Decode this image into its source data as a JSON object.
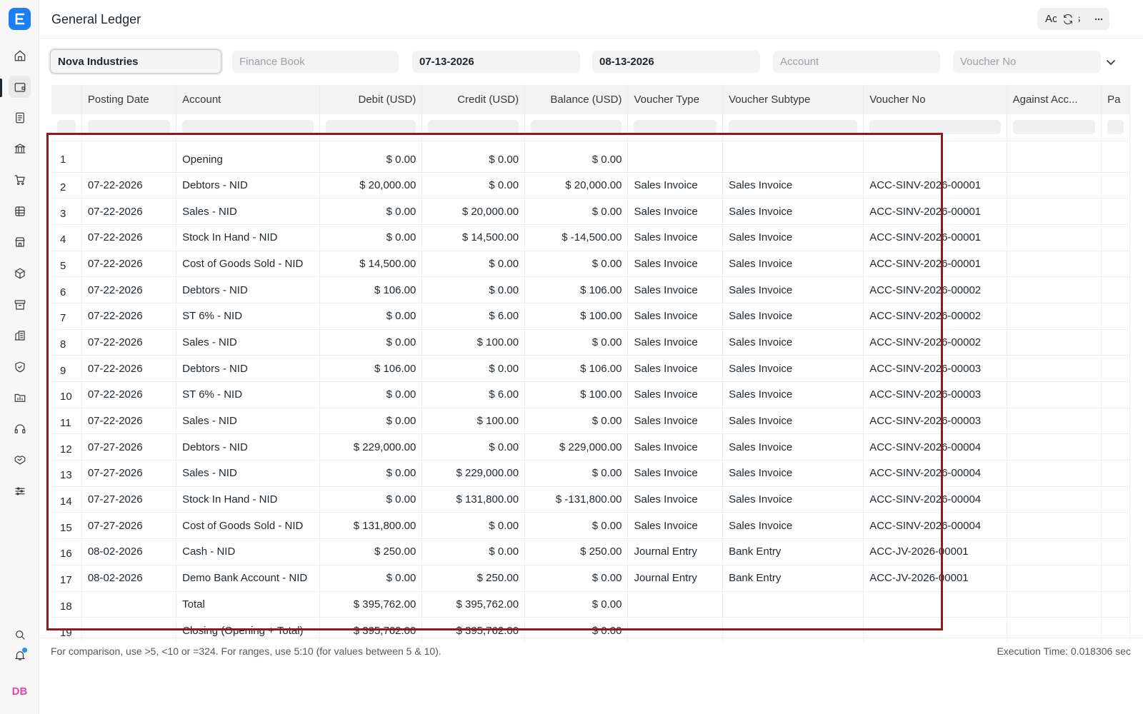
{
  "app": {
    "logo_letter": "E",
    "user_initials": "DB"
  },
  "header": {
    "title": "General Ledger",
    "actions_label": "Actions"
  },
  "filters": {
    "company": "Nova Industries",
    "finance_book_placeholder": "Finance Book",
    "from_date": "07-13-2026",
    "to_date": "08-13-2026",
    "account_placeholder": "Account",
    "voucher_no_placeholder": "Voucher No"
  },
  "table": {
    "columns": [
      "",
      "Posting Date",
      "Account",
      "Debit (USD)",
      "Credit (USD)",
      "Balance (USD)",
      "Voucher Type",
      "Voucher Subtype",
      "Voucher No",
      "Against Acc...",
      "Pa"
    ],
    "rows": [
      [
        "1",
        "",
        "Opening",
        "$ 0.00",
        "$ 0.00",
        "$ 0.00",
        "",
        "",
        "",
        "",
        ""
      ],
      [
        "2",
        "07-22-2026",
        "Debtors - NID",
        "$ 20,000.00",
        "$ 0.00",
        "$ 20,000.00",
        "Sales Invoice",
        "Sales Invoice",
        "ACC-SINV-2026-00001",
        "",
        ""
      ],
      [
        "3",
        "07-22-2026",
        "Sales - NID",
        "$ 0.00",
        "$ 20,000.00",
        "$ 0.00",
        "Sales Invoice",
        "Sales Invoice",
        "ACC-SINV-2026-00001",
        "",
        ""
      ],
      [
        "4",
        "07-22-2026",
        "Stock In Hand - NID",
        "$ 0.00",
        "$ 14,500.00",
        "$ -14,500.00",
        "Sales Invoice",
        "Sales Invoice",
        "ACC-SINV-2026-00001",
        "",
        ""
      ],
      [
        "5",
        "07-22-2026",
        "Cost of Goods Sold - NID",
        "$ 14,500.00",
        "$ 0.00",
        "$ 0.00",
        "Sales Invoice",
        "Sales Invoice",
        "ACC-SINV-2026-00001",
        "",
        ""
      ],
      [
        "6",
        "07-22-2026",
        "Debtors - NID",
        "$ 106.00",
        "$ 0.00",
        "$ 106.00",
        "Sales Invoice",
        "Sales Invoice",
        "ACC-SINV-2026-00002",
        "",
        ""
      ],
      [
        "7",
        "07-22-2026",
        "ST 6% - NID",
        "$ 0.00",
        "$ 6.00",
        "$ 100.00",
        "Sales Invoice",
        "Sales Invoice",
        "ACC-SINV-2026-00002",
        "",
        ""
      ],
      [
        "8",
        "07-22-2026",
        "Sales - NID",
        "$ 0.00",
        "$ 100.00",
        "$ 0.00",
        "Sales Invoice",
        "Sales Invoice",
        "ACC-SINV-2026-00002",
        "",
        ""
      ],
      [
        "9",
        "07-22-2026",
        "Debtors - NID",
        "$ 106.00",
        "$ 0.00",
        "$ 106.00",
        "Sales Invoice",
        "Sales Invoice",
        "ACC-SINV-2026-00003",
        "",
        ""
      ],
      [
        "10",
        "07-22-2026",
        "ST 6% - NID",
        "$ 0.00",
        "$ 6.00",
        "$ 100.00",
        "Sales Invoice",
        "Sales Invoice",
        "ACC-SINV-2026-00003",
        "",
        ""
      ],
      [
        "11",
        "07-22-2026",
        "Sales - NID",
        "$ 0.00",
        "$ 100.00",
        "$ 0.00",
        "Sales Invoice",
        "Sales Invoice",
        "ACC-SINV-2026-00003",
        "",
        ""
      ],
      [
        "12",
        "07-27-2026",
        "Debtors - NID",
        "$ 229,000.00",
        "$ 0.00",
        "$ 229,000.00",
        "Sales Invoice",
        "Sales Invoice",
        "ACC-SINV-2026-00004",
        "",
        ""
      ],
      [
        "13",
        "07-27-2026",
        "Sales - NID",
        "$ 0.00",
        "$ 229,000.00",
        "$ 0.00",
        "Sales Invoice",
        "Sales Invoice",
        "ACC-SINV-2026-00004",
        "",
        ""
      ],
      [
        "14",
        "07-27-2026",
        "Stock In Hand - NID",
        "$ 0.00",
        "$ 131,800.00",
        "$ -131,800.00",
        "Sales Invoice",
        "Sales Invoice",
        "ACC-SINV-2026-00004",
        "",
        ""
      ],
      [
        "15",
        "07-27-2026",
        "Cost of Goods Sold - NID",
        "$ 131,800.00",
        "$ 0.00",
        "$ 0.00",
        "Sales Invoice",
        "Sales Invoice",
        "ACC-SINV-2026-00004",
        "",
        ""
      ],
      [
        "16",
        "08-02-2026",
        "Cash - NID",
        "$ 250.00",
        "$ 0.00",
        "$ 250.00",
        "Journal Entry",
        "Bank Entry",
        "ACC-JV-2026-00001",
        "",
        ""
      ],
      [
        "17",
        "08-02-2026",
        "Demo Bank Account - NID",
        "$ 0.00",
        "$ 250.00",
        "$ 0.00",
        "Journal Entry",
        "Bank Entry",
        "ACC-JV-2026-00001",
        "",
        ""
      ],
      [
        "18",
        "",
        "Total",
        "$ 395,762.00",
        "$ 395,762.00",
        "$ 0.00",
        "",
        "",
        "",
        "",
        ""
      ],
      [
        "19",
        "",
        "Closing (Opening + Total)",
        "$ 395,762.00",
        "$ 395,762.00",
        "$ 0.00",
        "",
        "",
        "",
        "",
        ""
      ]
    ]
  },
  "footer": {
    "hint": "For comparison, use >5, <10 or =324. For ranges, use 5:10 (for values between 5 & 10).",
    "execution_time": "Execution Time: 0.018306 sec"
  }
}
